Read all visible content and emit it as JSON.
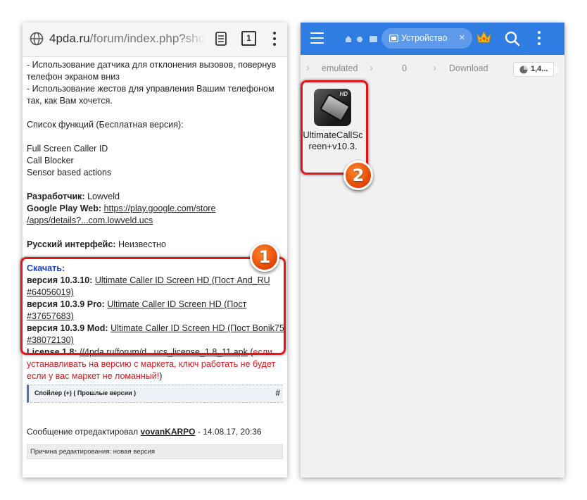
{
  "browser": {
    "url_host": "4pda.ru",
    "url_path": "/forum/index.php?showto",
    "tab_count": "1"
  },
  "post": {
    "lines_top": [
      "- Использование датчика для отклонения вызовов, повернув",
      "телефон экраном вниз",
      "- Использование жестов для управления Вашим телефоном",
      "так, как Вам хочется."
    ],
    "features_heading": "Список функций (Бесплатная версия):",
    "features": [
      "Full Screen Caller ID",
      "Call Blocker",
      "Sensor based actions"
    ],
    "developer_label": "Разработчик:",
    "developer_value": "Lowveld",
    "gplay_label": "Google Play Web:",
    "gplay_link_1": "https://play.google.com/store",
    "gplay_link_2": "/apps/details?...com.lowveld.ucs",
    "russian_label": "Русский интерфейс:",
    "russian_value": "Неизвестно",
    "download_label": "Скачать:",
    "v1_label": "версия 10.3.10:",
    "v1_link_a": "Ultimate Caller ID Screen HD (Пост And_RU",
    "v1_link_b": "#64056019)",
    "v2_label": "версия 10.3.9 Pro:",
    "v2_link": "Ultimate Caller ID Screen HD (Пост #37657683)",
    "v3_label": "версия 10.3.9 Mod:",
    "v3_link_a": "Ultimate Caller ID Screen HD (Пост Bonik75",
    "v3_link_b": "#38072130)",
    "license_label": "License 1.8:",
    "license_link": "//4pda.ru/forum/d...ucs_license_1.8_11.apk",
    "license_note_open": " (",
    "license_note_a": "если",
    "license_note_b": "устанавливать на версию с маркета, ключ работать не будет",
    "license_note_c": "если у вас маркет не ломанный!",
    "license_note_close": ")",
    "spoiler_label": "Спойлер (+) ( Прошлые версии )",
    "spoiler_hash": "#",
    "edited_prefix": "Сообщение отредактировал ",
    "edited_user": "vovanKARPO",
    "edited_suffix": " - 14.08.17, 20:36",
    "edit_reason": "Причина редактирования: новая версия"
  },
  "file_manager": {
    "tab_label": "Устройство",
    "close_glyph": "×",
    "path": [
      "emulated",
      "0",
      "Download"
    ],
    "storage_label": "1,4...",
    "file_name": "UltimateCallScreen+v10.3.",
    "icon_badge": "HD",
    "accent": "#2f7de3"
  },
  "callouts": {
    "badge_1": "1",
    "badge_2": "2",
    "color": "#e3141a"
  }
}
